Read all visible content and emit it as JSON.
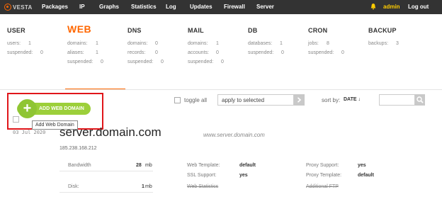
{
  "nav": {
    "logo": "VESTA",
    "items": [
      "Packages",
      "IP",
      "Graphs",
      "Statistics",
      "Log",
      "Updates",
      "Firewall",
      "Server"
    ],
    "user": "admin",
    "logout": "Log out"
  },
  "stats": {
    "user": {
      "title": "USER",
      "users_label": "users:",
      "users": "1",
      "suspended_label": "suspended:",
      "suspended": "0"
    },
    "web": {
      "title": "WEB",
      "domains_label": "domains:",
      "domains": "1",
      "aliases_label": "aliases:",
      "aliases": "1",
      "suspended_label": "suspended:",
      "suspended": "0"
    },
    "dns": {
      "title": "DNS",
      "domains_label": "domains:",
      "domains": "0",
      "records_label": "records:",
      "records": "0",
      "suspended_label": "suspended:",
      "suspended": "0"
    },
    "mail": {
      "title": "MAIL",
      "domains_label": "domains:",
      "domains": "1",
      "accounts_label": "accounts:",
      "accounts": "0",
      "suspended_label": "suspended:",
      "suspended": "0"
    },
    "db": {
      "title": "DB",
      "databases_label": "databases:",
      "databases": "1",
      "suspended_label": "suspended:",
      "suspended": "0"
    },
    "cron": {
      "title": "CRON",
      "jobs_label": "jobs:",
      "jobs": "8",
      "suspended_label": "suspended:",
      "suspended": "0"
    },
    "backup": {
      "title": "BACKUP",
      "backups_label": "backups:",
      "backups": "3"
    }
  },
  "toolbar": {
    "add_label": "ADD WEB DOMAIN",
    "add_tooltip": "Add Web Domain",
    "toggle_all": "toggle all",
    "apply_selected": "apply to selected",
    "sort_label": "sort by:",
    "sort_value": "DATE ↓",
    "search_placeholder": ""
  },
  "domain": {
    "date": "03 Jul 2020",
    "name": "server.domain.com",
    "alias": "www.server.domain.com",
    "ip": "185.238.168.212",
    "bandwidth_label": "Bandwidth",
    "bandwidth_value": "28",
    "bandwidth_unit": "mb",
    "disk_label": "Disk:",
    "disk_value": "1",
    "disk_unit": "mb",
    "web_template_label": "Web Template:",
    "web_template": "default",
    "ssl_label": "SSL Support:",
    "ssl": "yes",
    "web_statistics": "Web Statistics",
    "proxy_support_label": "Proxy Support:",
    "proxy_support": "yes",
    "proxy_template_label": "Proxy Template:",
    "proxy_template": "default",
    "additional_ftp": "Additional FTP"
  },
  "colors": {
    "accent": "#ff6701",
    "nav_bg": "#333333",
    "add_button": "#9ccf3a",
    "highlight": "#e0161a",
    "user_name": "#ffcc00"
  }
}
